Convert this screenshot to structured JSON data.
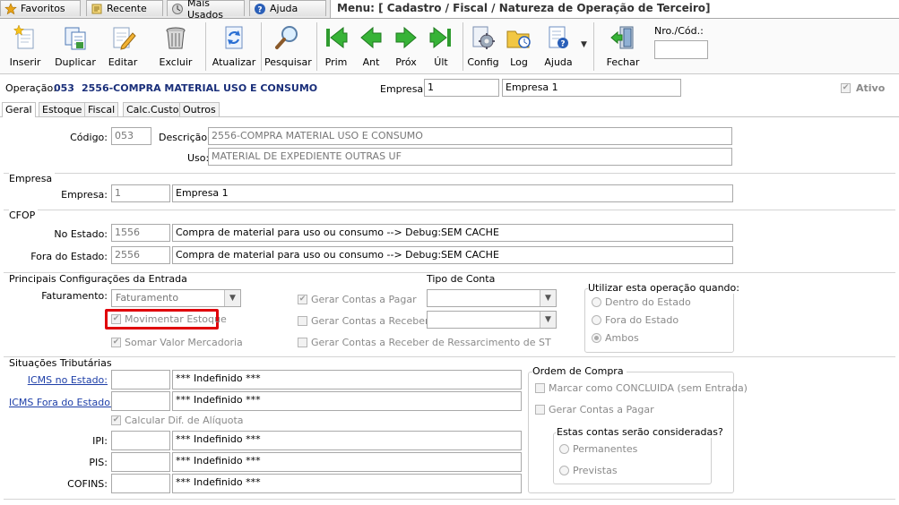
{
  "top_tabs": [
    {
      "label": "Favoritos",
      "icon": "star-icon"
    },
    {
      "label": "Recente",
      "icon": "history-icon"
    },
    {
      "label": "Mais Usados",
      "icon": "most-used-icon"
    },
    {
      "label": "Ajuda",
      "icon": "help-icon"
    }
  ],
  "menu_title": "Menu: [ Cadastro / Fiscal / Natureza de Operação de Terceiro]",
  "toolbar": {
    "buttons": [
      {
        "label": "Inserir"
      },
      {
        "label": "Duplicar"
      },
      {
        "label": "Editar"
      },
      {
        "label": "Excluir"
      },
      {
        "label": "Atualizar"
      },
      {
        "label": "Pesquisar"
      },
      {
        "label": "Prim"
      },
      {
        "label": "Ant"
      },
      {
        "label": "Próx"
      },
      {
        "label": "Últ"
      },
      {
        "label": "Config"
      },
      {
        "label": "Log"
      },
      {
        "label": "Ajuda"
      },
      {
        "label": "Fechar"
      }
    ],
    "nro_label": "Nro./Cód.:",
    "nro_value": ""
  },
  "header": {
    "operacao_label": "Operação:",
    "operacao_code": "053",
    "operacao_desc": "2556-COMPRA MATERIAL USO E CONSUMO",
    "empresa_label": "Empresa:",
    "empresa_code": "1",
    "empresa_name": "Empresa 1",
    "ativo_label": "Ativo"
  },
  "sub_tabs": [
    "Geral",
    "Estoque",
    "Fiscal",
    "Calc.Custo",
    "Outros"
  ],
  "main": {
    "codigo_label": "Código:",
    "codigo_value": "053",
    "descricao_label": "Descrição:",
    "descricao_value": "2556-COMPRA MATERIAL USO E CONSUMO",
    "uso_label": "Uso:",
    "uso_value": "MATERIAL DE EXPEDIENTE OUTRAS UF"
  },
  "empresa_section": {
    "title": "Empresa",
    "label": "Empresa:",
    "code": "1",
    "name": "Empresa 1"
  },
  "cfop": {
    "title": "CFOP",
    "no_estado_label": "No Estado:",
    "no_estado_code": "1556",
    "no_estado_desc": "Compra de material para uso ou consumo   --> Debug:SEM CACHE",
    "fora_estado_label": "Fora do Estado:",
    "fora_estado_code": "2556",
    "fora_estado_desc": "Compra de material para uso ou consumo   --> Debug:SEM CACHE"
  },
  "config": {
    "title": "Principais Configurações da Entrada",
    "faturamento_label": "Faturamento:",
    "faturamento_value": "Faturamento",
    "movimentar_estoque": "Movimentar Estoque",
    "somar_valor": "Somar Valor Mercadoria",
    "gerar_pagar": "Gerar Contas a Pagar",
    "gerar_receber": "Gerar Contas a Receber",
    "gerar_ressarcimento": "Gerar Contas a Receber de Ressarcimento de ST",
    "tipo_conta_title": "Tipo de Conta",
    "tipo_conta_1": "",
    "tipo_conta_2": "",
    "utilizar_title": "Utilizar esta operação quando:",
    "radio_dentro": "Dentro do  Estado",
    "radio_fora": "Fora do Estado",
    "radio_ambos": "Ambos",
    "highlight_color": "#e0000a"
  },
  "situacoes": {
    "title": "Situações Tributárias",
    "icms_estado_label": "ICMS no Estado:",
    "icms_estado_code": "",
    "icms_estado_desc": "*** Indefinido ***",
    "icms_fora_label": "ICMS Fora do Estado:",
    "icms_fora_code": "",
    "icms_fora_desc": "*** Indefinido ***",
    "calcular_dif": "Calcular Dif. de Alíquota",
    "ipi_label": "IPI:",
    "ipi_code": "",
    "ipi_desc": "*** Indefinido ***",
    "pis_label": "PIS:",
    "pis_code": "",
    "pis_desc": "*** Indefinido ***",
    "cofins_label": "COFINS:",
    "cofins_code": "",
    "cofins_desc": "*** Indefinido ***"
  },
  "ordem_compra": {
    "title": "Ordem de Compra",
    "marcar_concluida": "Marcar como CONCLUIDA (sem Entrada)",
    "gerar_pagar": "Gerar Contas a Pagar",
    "contas_title": "Estas contas serão consideradas?",
    "permanentes": "Permanentes",
    "previstas": "Previstas"
  }
}
